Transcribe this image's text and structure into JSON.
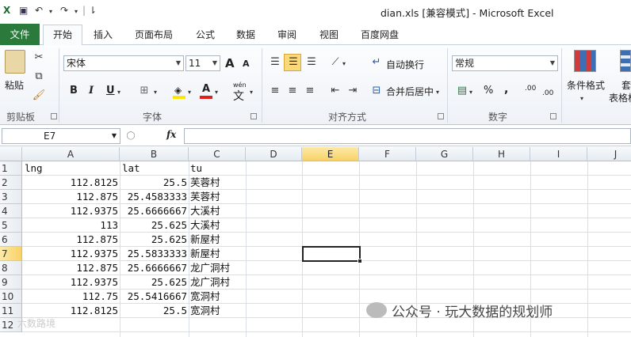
{
  "window": {
    "title": "dian.xls  [兼容模式] - Microsoft Excel"
  },
  "quick_access": {
    "save_icon": "save-icon",
    "undo_icon": "undo-icon",
    "redo_icon": "redo-icon",
    "sep": "|",
    "more": "⇂"
  },
  "tabs": [
    "文件",
    "开始",
    "插入",
    "页面布局",
    "公式",
    "数据",
    "审阅",
    "视图",
    "百度网盘"
  ],
  "ribbon": {
    "clipboard": {
      "paste": "粘贴",
      "label": "剪贴板"
    },
    "font": {
      "name": "宋体",
      "size": "11",
      "grow": "A",
      "shrink": "A",
      "bold": "B",
      "italic": "I",
      "underline": "U",
      "label": "字体",
      "wen": "wén",
      "wen_char": "文"
    },
    "align": {
      "wrap": "自动换行",
      "merge": "合并后居中",
      "label": "对齐方式"
    },
    "number": {
      "format": "常规",
      "percent": "%",
      "comma": ",",
      "inc": ".00",
      "dec": ".00",
      "label": "数字"
    },
    "styles": {
      "cond_format": "条件格式",
      "table_format_1": "套",
      "table_format_2": "表格格"
    }
  },
  "formula_bar": {
    "name_box": "E7",
    "fx": "fx",
    "value": ""
  },
  "columns": [
    "A",
    "B",
    "C",
    "D",
    "E",
    "F",
    "G",
    "H",
    "I",
    "J"
  ],
  "active": {
    "col": "E",
    "row": "7"
  },
  "rows": [
    "1",
    "2",
    "3",
    "4",
    "5",
    "6",
    "7",
    "8",
    "9",
    "10",
    "11",
    "12"
  ],
  "sheet": {
    "header": [
      "lng",
      "lat",
      "tu"
    ],
    "data": [
      [
        "112.8125",
        "25.5",
        "芙蓉村"
      ],
      [
        "112.875",
        "25.4583333",
        "芙蓉村"
      ],
      [
        "112.9375",
        "25.6666667",
        "大溪村"
      ],
      [
        "113",
        "25.625",
        "大溪村"
      ],
      [
        "112.875",
        "25.625",
        "新屋村"
      ],
      [
        "112.9375",
        "25.5833333",
        "新屋村"
      ],
      [
        "112.875",
        "25.6666667",
        "龙广洞村"
      ],
      [
        "112.9375",
        "25.625",
        "龙广洞村"
      ],
      [
        "112.75",
        "25.5416667",
        "宽洞村"
      ],
      [
        "112.8125",
        "25.5",
        "宽洞村"
      ]
    ]
  },
  "watermark": {
    "text": "公众号 · 玩大数据的规划师",
    "corner": "六数路境"
  }
}
